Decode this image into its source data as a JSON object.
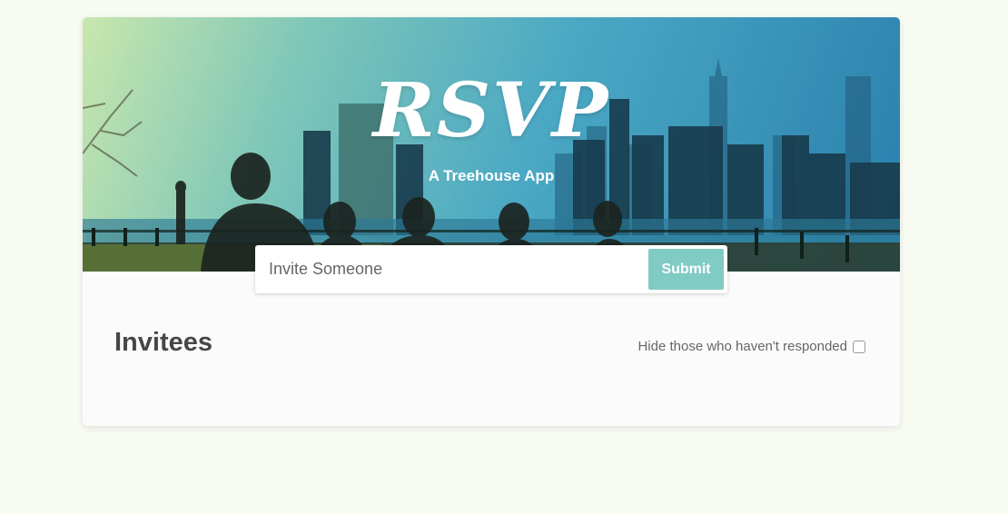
{
  "header": {
    "title": "RSVP",
    "subtitle": "A Treehouse App"
  },
  "invite": {
    "placeholder": "Invite Someone",
    "submit_label": "Submit"
  },
  "main": {
    "heading": "Invitees",
    "filter_label": "Hide those who haven't responded",
    "filter_checked": false
  },
  "colors": {
    "page_background": "#f7fbf2",
    "card_background": "#fbfbfb",
    "submit_button": "#80cbc4",
    "heading_text": "#474747"
  },
  "icons": {
    "banner": "city-skyline-photo"
  }
}
